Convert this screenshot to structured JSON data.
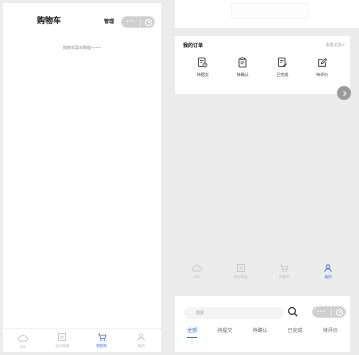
{
  "cart": {
    "title": "购物车",
    "manage": "管理",
    "capsule_more": "•••",
    "empty_text": "购物车暂未数据~~~"
  },
  "tabbar": {
    "items": [
      {
        "label": "DIY",
        "icon": "cloud-icon",
        "active": false
      },
      {
        "label": "设计商品",
        "icon": "design-icon",
        "active": false
      },
      {
        "label": "购物车",
        "icon": "cart-icon",
        "active": true
      },
      {
        "label": "我的",
        "icon": "user-icon",
        "active": false
      }
    ]
  },
  "orders": {
    "title": "我的订单",
    "view_all": "查看全部>",
    "items": [
      {
        "label": "待提交",
        "icon": "pending-submit-icon"
      },
      {
        "label": "待确认",
        "icon": "clipboard-icon"
      },
      {
        "label": "已完成",
        "icon": "completed-doc-icon"
      },
      {
        "label": "待评价",
        "icon": "review-edit-icon"
      }
    ]
  },
  "tabbar_mine": {
    "items": [
      {
        "label": "DIY",
        "icon": "cloud-icon",
        "active": false
      },
      {
        "label": "设计商品",
        "icon": "design-icon",
        "active": false
      },
      {
        "label": "购物车",
        "icon": "cart-icon",
        "active": false
      },
      {
        "label": "我的",
        "icon": "user-icon",
        "active": true
      }
    ]
  },
  "order_list": {
    "search_placeholder": "搜索",
    "capsule_more": "•••",
    "tabs": [
      {
        "label": "全部",
        "active": true
      },
      {
        "label": "待提交",
        "active": false
      },
      {
        "label": "待确认",
        "active": false
      },
      {
        "label": "已完成",
        "active": false
      },
      {
        "label": "待评价",
        "active": false
      }
    ]
  },
  "colors": {
    "accent": "#2b6be3",
    "inactive": "#b5b5b5",
    "background": "#ececec"
  }
}
